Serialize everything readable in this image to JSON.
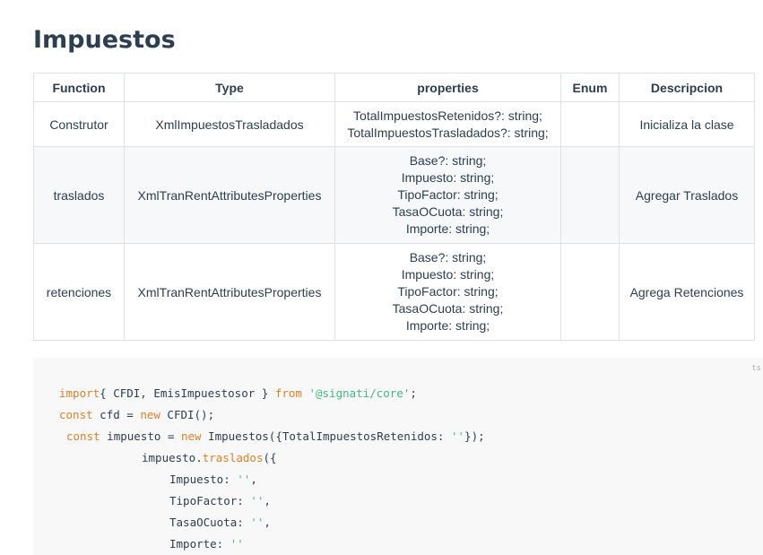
{
  "page_title": "Impuestos",
  "table": {
    "headers": [
      "Function",
      "Type",
      "properties",
      "Enum",
      "Descripcion"
    ],
    "rows": [
      {
        "function": "Construtor",
        "type": "XmlImpuestosTrasladados",
        "properties": [
          "TotalImpuestosRetenidos?: string;",
          "TotalImpuestosTrasladados?: string;"
        ],
        "enum": "",
        "descripcion": "Inicializa la clase"
      },
      {
        "function": "traslados",
        "type": "XmlTranRentAttributesProperties",
        "properties": [
          "Base?: string;",
          "Impuesto: string;",
          "TipoFactor: string;",
          "TasaOCuota: string;",
          "Importe: string;"
        ],
        "enum": "",
        "descripcion": "Agregar Traslados"
      },
      {
        "function": "retenciones",
        "type": "XmlTranRentAttributesProperties",
        "properties": [
          "Base?: string;",
          "Impuesto: string;",
          "TipoFactor: string;",
          "TasaOCuota: string;",
          "Importe: string;"
        ],
        "enum": "",
        "descripcion": "Agrega Retenciones"
      }
    ]
  },
  "code": {
    "language": "ts",
    "lines": [
      {
        "tokens": [
          [
            "kw",
            "import"
          ],
          [
            "",
            "{ CFDI, EmisImpuestosor } "
          ],
          [
            "kw",
            "from"
          ],
          [
            "",
            " "
          ],
          [
            "str",
            "'@signati/core'"
          ],
          [
            "",
            ";"
          ]
        ]
      },
      {
        "tokens": [
          [
            "kw",
            "const"
          ],
          [
            "",
            " cfd = "
          ],
          [
            "kw",
            "new"
          ],
          [
            "",
            " CFDI();"
          ]
        ]
      },
      {
        "tokens": [
          [
            "",
            ""
          ],
          [
            "kw",
            "const"
          ],
          [
            "",
            " impuesto = "
          ],
          [
            "kw",
            "new"
          ],
          [
            "",
            " Impuestos({TotalImpuestosRetenidos: "
          ],
          [
            "str",
            "''"
          ],
          [
            "",
            "});"
          ]
        ]
      },
      {
        "tokens": [
          [
            "",
            "impuesto."
          ],
          [
            "fn",
            "traslados"
          ],
          [
            "",
            "({"
          ]
        ]
      },
      {
        "tokens": [
          [
            "",
            "Impuesto: "
          ],
          [
            "str",
            "''"
          ],
          [
            "",
            ","
          ]
        ]
      },
      {
        "tokens": [
          [
            "",
            "TipoFactor: "
          ],
          [
            "str",
            "''"
          ],
          [
            "",
            ","
          ]
        ]
      },
      {
        "tokens": [
          [
            "",
            "TasaOCuota: "
          ],
          [
            "str",
            "''"
          ],
          [
            "",
            ","
          ]
        ]
      },
      {
        "tokens": [
          [
            "",
            "Importe: "
          ],
          [
            "str",
            "''"
          ]
        ]
      }
    ]
  },
  "colors": {
    "heading": "#2c3e50",
    "table_border": "#dfe2e5",
    "code_background": "#f8f8f8",
    "keyword": "#d9822b",
    "string": "#42b983"
  }
}
